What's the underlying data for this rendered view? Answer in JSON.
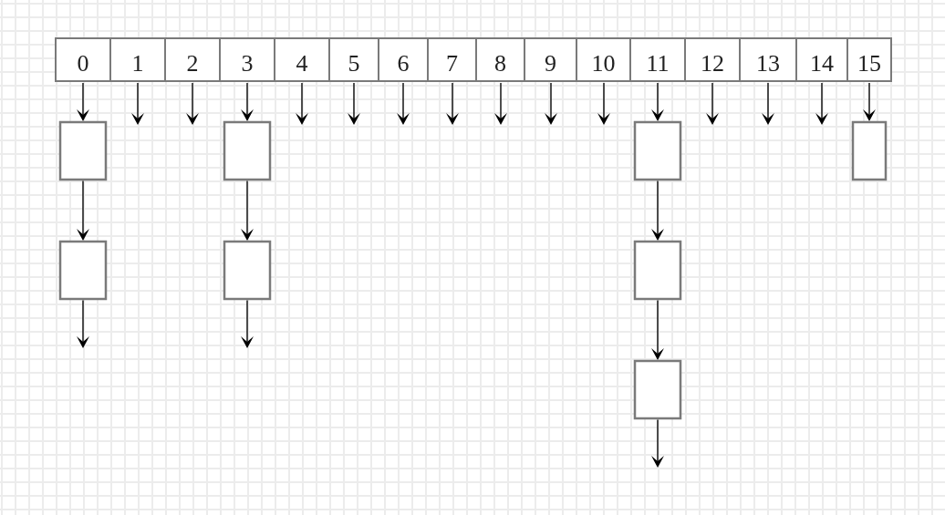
{
  "hash_table": {
    "buckets": [
      {
        "label": "0",
        "chain": [
          {
            "kind": "node"
          },
          {
            "kind": "node"
          }
        ],
        "tail_arrow": true
      },
      {
        "label": "1"
      },
      {
        "label": "2"
      },
      {
        "label": "3",
        "chain": [
          {
            "kind": "node"
          },
          {
            "kind": "node"
          }
        ],
        "tail_arrow": true
      },
      {
        "label": "4"
      },
      {
        "label": "5"
      },
      {
        "label": "6"
      },
      {
        "label": "7"
      },
      {
        "label": "8"
      },
      {
        "label": "9"
      },
      {
        "label": "10"
      },
      {
        "label": "11",
        "chain": [
          {
            "kind": "node"
          },
          {
            "kind": "node"
          },
          {
            "kind": "node"
          }
        ],
        "tail_arrow": true
      },
      {
        "label": "12"
      },
      {
        "label": "13"
      },
      {
        "label": "14"
      },
      {
        "label": "15",
        "chain": [
          {
            "kind": "node"
          }
        ],
        "tail_arrow": false
      }
    ]
  }
}
